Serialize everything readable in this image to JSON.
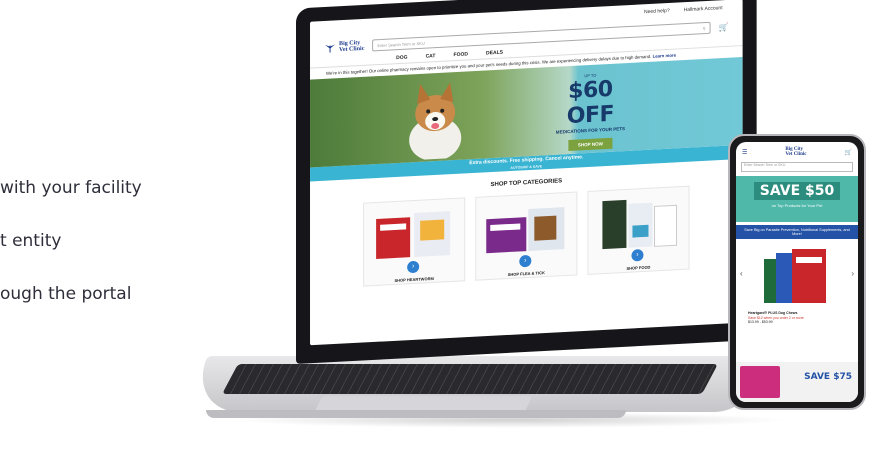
{
  "side_text": {
    "line1": "with your facility",
    "line2": "t entity",
    "line3": "ough the portal"
  },
  "site": {
    "brand_line1": "Big City",
    "brand_line2": "Vet Clinic",
    "top_links": [
      "Need help?",
      "Hallmark Account"
    ],
    "search_placeholder": "Enter Search Term or SKU",
    "nav": [
      "DOG",
      "CAT",
      "FOOD",
      "DEALS"
    ],
    "notice": "We're in this together! Our online pharmacy remains open to prioritize you and your pet's needs during this crisis. We are experiencing delivery delays due to high demand.",
    "notice_link": "Learn more",
    "hero_upto": "UP TO",
    "hero_amount": "$60 OFF",
    "hero_sub": "MEDICATIONS FOR YOUR PETS",
    "hero_button": "SHOP NOW",
    "autoship_text": "Extra discounts. Free shipping. Cancel anytime.",
    "autoship_link": "AUTOSHIP & SAVE",
    "categories_title": "SHOP TOP CATEGORIES",
    "categories": [
      {
        "label": "SHOP HEARTWORM",
        "color": "#c8262b"
      },
      {
        "label": "SHOP FLEA & TICK",
        "color": "#7a2a8a"
      },
      {
        "label": "SHOP FOOD",
        "color": "#2a3f2a"
      }
    ]
  },
  "phone": {
    "brand_line1": "Big City",
    "brand_line2": "Vet Clinic",
    "search_placeholder": "Enter Search Term or SKU",
    "save": "SAVE $50",
    "save_sub": "on Top Products for Your Pet",
    "blue_banner": "Save Big on Parasite Prevention, Nutritional Supplements, and More!",
    "product_name": "Heartgard® PLUS Dog Chews",
    "product_promo": "Save $12 when you order 2 or more",
    "product_price": "$13.99 - $53.99",
    "bottom_save": "SAVE $75"
  },
  "colors": {
    "brand_blue": "#1b3a8c",
    "hero_teal": "#71c8d6",
    "autoship_blue": "#39b4d2",
    "cta_green": "#7ba23f",
    "phone_teal": "#4fb8a9"
  }
}
